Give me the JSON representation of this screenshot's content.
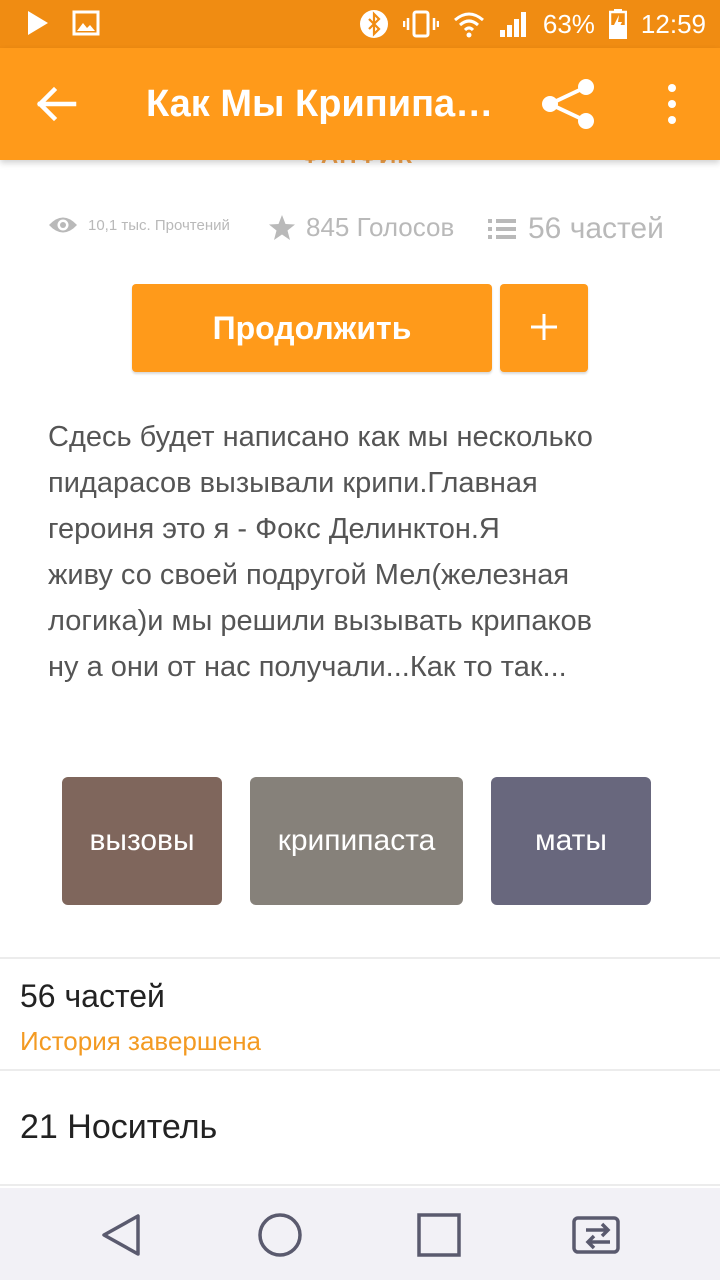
{
  "status_bar": {
    "battery": "63%",
    "time": "12:59"
  },
  "app_bar": {
    "title": "Как Мы Крипипа…"
  },
  "story": {
    "category": "ФАНФИК",
    "reads": "10,1 тыс. Прочтений",
    "votes": "845 Голосов",
    "parts": "56 частей",
    "continue_label": "Продолжить",
    "add_label": "+",
    "description": [
      "Сдесь будет написано как мы несколько",
      "пидарасов вызывали крипи.Главная",
      "героиня это я - Фокс Делинктон.Я",
      "живу со своей подругой Мел(железная",
      "логика)и мы решили вызывать крипаков",
      "ну а они от нас получали...Как то так..."
    ],
    "tags": [
      {
        "label": "вызовы",
        "color": "#7f665c"
      },
      {
        "label": "крипипаста",
        "color": "#86817a"
      },
      {
        "label": "маты",
        "color": "#68677d"
      }
    ],
    "parts_count": "56 частей",
    "completion": "История завершена",
    "media_count": "21 Носитель"
  },
  "colors": {
    "accent": "#ff9a1a",
    "status": "#f08c12"
  }
}
